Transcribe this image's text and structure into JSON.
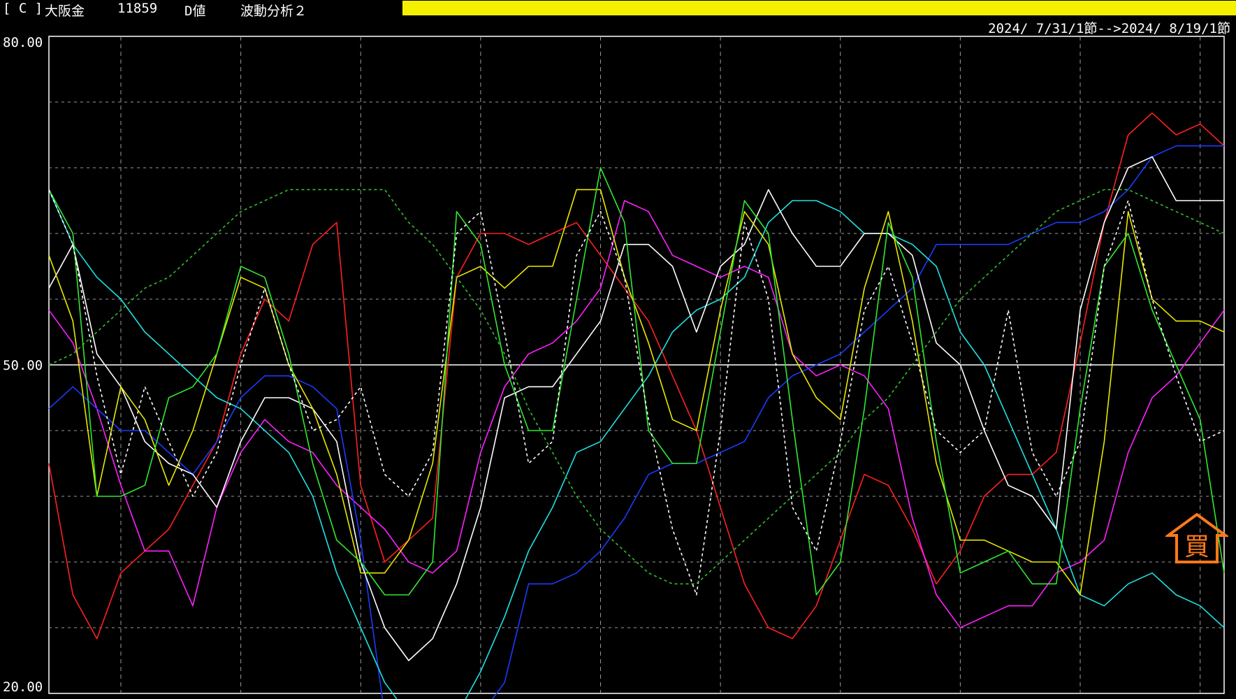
{
  "header": {
    "code": "[ C ]",
    "name": "大阪金",
    "price": "11859",
    "mode": "D値",
    "analysis": "波動分析２",
    "range": "2024/ 7/31/1節-->2024/ 8/19/1節",
    "bar_color": "#f4f000"
  },
  "axis": {
    "y_top": "80.00",
    "y_mid": "50.00",
    "y_bottom": "20.00"
  },
  "colors": {
    "background": "#000000",
    "grid": "#9a9a9a",
    "mid_line": "#ffffff",
    "buy_marker": "#ff7a1a"
  },
  "chart_data": {
    "type": "line",
    "ylim": [
      20,
      80
    ],
    "x": [
      0,
      1,
      2,
      3,
      4,
      5,
      6,
      7,
      8,
      9,
      10,
      11,
      12,
      13,
      14,
      15,
      16,
      17,
      18,
      19,
      20,
      21,
      22,
      23,
      24,
      25,
      26,
      27,
      28,
      29,
      30,
      31,
      32,
      33,
      34,
      35,
      36,
      37,
      38,
      39,
      40,
      41,
      42,
      43,
      44,
      45,
      46,
      47,
      48,
      49
    ],
    "gridlines_y": [
      20,
      26,
      32,
      38,
      44,
      50,
      56,
      62,
      68,
      74,
      80
    ],
    "gridlines_x": [
      3,
      8,
      13,
      18,
      23,
      28,
      33,
      38,
      43,
      48
    ],
    "series": [
      {
        "color": "#ff2020",
        "style": "solid",
        "values": [
          41,
          29,
          25,
          31,
          33,
          35,
          39,
          43,
          51,
          56,
          54,
          61,
          63,
          39,
          32,
          34,
          36,
          58,
          62,
          62,
          61,
          62,
          63,
          60,
          57,
          54,
          49,
          44,
          37,
          30,
          26,
          25,
          28,
          34,
          40,
          39,
          35,
          30,
          33,
          38,
          40,
          40,
          42,
          52,
          63,
          71,
          73,
          71,
          72,
          70
        ]
      },
      {
        "color": "#ff20ff",
        "style": "solid",
        "values": [
          55,
          52,
          46,
          39,
          33,
          33,
          28,
          37,
          42,
          45,
          43,
          42,
          39,
          37,
          35,
          32,
          31,
          33,
          42,
          48,
          51,
          52,
          54,
          57,
          65,
          64,
          60,
          59,
          58,
          59,
          58,
          51,
          49,
          50,
          49,
          46,
          36,
          29,
          26,
          27,
          28,
          28,
          31,
          32,
          34,
          42,
          47,
          49,
          52,
          55
        ]
      },
      {
        "color": "#1a3cff",
        "style": "solid",
        "values": [
          46,
          48,
          46,
          44,
          44,
          42,
          40,
          43,
          47,
          49,
          49,
          48,
          46,
          34,
          18,
          14,
          14,
          14,
          14,
          21,
          30,
          30,
          31,
          33,
          36,
          40,
          41,
          41,
          42,
          43,
          47,
          49,
          50,
          51,
          53,
          55,
          57,
          61,
          61,
          61,
          61,
          62,
          63,
          63,
          64,
          66,
          69,
          70,
          70,
          70
        ]
      },
      {
        "color": "#20e0e0",
        "style": "solid",
        "values": [
          66,
          61,
          58,
          56,
          53,
          51,
          49,
          47,
          46,
          44,
          42,
          38,
          31,
          26,
          21,
          17,
          14,
          14,
          22,
          27,
          33,
          37,
          42,
          43,
          46,
          49,
          53,
          55,
          56,
          58,
          63,
          65,
          65,
          64,
          62,
          62,
          61,
          59,
          53,
          50,
          45,
          40,
          35,
          29,
          28,
          30,
          31,
          29,
          28,
          26
        ]
      },
      {
        "color": "#ffffff",
        "style": "solid",
        "values": [
          57,
          61,
          51,
          48,
          43,
          41,
          40,
          37,
          43,
          47,
          47,
          46,
          43,
          32,
          26,
          23,
          25,
          30,
          37,
          47,
          48,
          48,
          51,
          54,
          61,
          61,
          59,
          53,
          59,
          61,
          66,
          62,
          59,
          59,
          62,
          62,
          60,
          52,
          50,
          44,
          39,
          38,
          35,
          55,
          63,
          68,
          69,
          65,
          65,
          65
        ]
      },
      {
        "color": "#e8e800",
        "style": "solid",
        "values": [
          60,
          54,
          38,
          48,
          45,
          39,
          44,
          51,
          58,
          57,
          50,
          46,
          40,
          31,
          31,
          34,
          41,
          58,
          59,
          57,
          59,
          59,
          66,
          66,
          58,
          52,
          45,
          44,
          55,
          64,
          61,
          51,
          47,
          45,
          57,
          64,
          54,
          41,
          34,
          34,
          33,
          32,
          32,
          29,
          43,
          64,
          56,
          54,
          54,
          53
        ]
      },
      {
        "color": "#30e830",
        "style": "solid",
        "values": [
          66,
          62,
          38,
          38,
          39,
          47,
          48,
          51,
          59,
          58,
          51,
          41,
          34,
          32,
          29,
          29,
          32,
          64,
          61,
          50,
          44,
          44,
          56,
          68,
          63,
          44,
          41,
          41,
          53,
          65,
          62,
          45,
          29,
          32,
          46,
          63,
          58,
          43,
          31,
          32,
          33,
          30,
          30,
          46,
          59,
          62,
          55,
          50,
          45,
          31
        ]
      },
      {
        "color": "#ffffff",
        "style": "dashed",
        "values": [
          66,
          61,
          49,
          40,
          48,
          43,
          38,
          42,
          50,
          57,
          50,
          44,
          45,
          48,
          40,
          38,
          42,
          62,
          64,
          53,
          41,
          43,
          60,
          64,
          58,
          45,
          35,
          29,
          44,
          63,
          56,
          37,
          33,
          43,
          55,
          59,
          52,
          44,
          42,
          44,
          55,
          42,
          38,
          43,
          59,
          65,
          56,
          49,
          43,
          44
        ]
      },
      {
        "color": "#30c030",
        "style": "dashed",
        "values": [
          50,
          51,
          53,
          55,
          57,
          58,
          60,
          62,
          64,
          65,
          66,
          66,
          66,
          66,
          66,
          63,
          61,
          58,
          55,
          51,
          46,
          42,
          38,
          35,
          33,
          31,
          30,
          30,
          32,
          34,
          36,
          38,
          40,
          42,
          45,
          47,
          50,
          53,
          56,
          58,
          60,
          62,
          64,
          65,
          66,
          66,
          65,
          64,
          63,
          62
        ]
      }
    ]
  },
  "buy_marker": {
    "char": "買",
    "label": "買"
  }
}
